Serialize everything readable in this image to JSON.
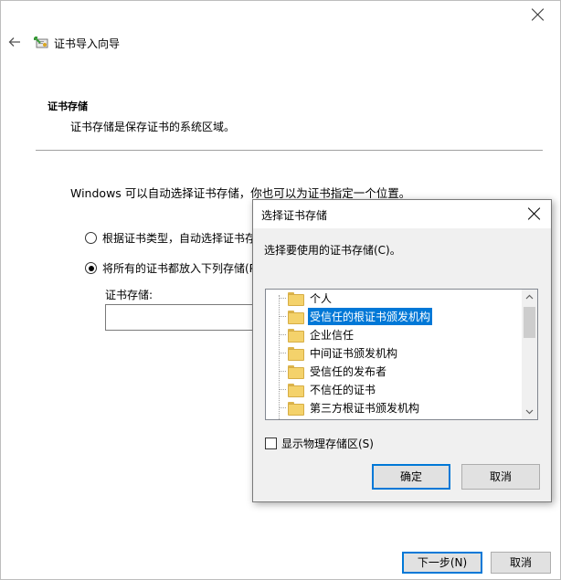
{
  "wizard": {
    "title": "证书导入向导",
    "section_title": "证书存储",
    "section_desc": "证书存储是保存证书的系统区域。",
    "intro": "Windows 可以自动选择证书存储，你也可以为证书指定一个位置。",
    "radio_auto_label": "根据证书类型，自动选择证书存",
    "radio_manual_label": "将所有的证书都放入下列存储(P",
    "store_label": "证书存储:",
    "store_value": "",
    "next_label": "下一步(N)",
    "cancel_label": "取消"
  },
  "dialog": {
    "title": "选择证书存储",
    "prompt": "选择要使用的证书存储(C)。",
    "stores": [
      "个人",
      "受信任的根证书颁发机构",
      "企业信任",
      "中间证书颁发机构",
      "受信任的发布者",
      "不信任的证书",
      "第三方根证书颁发机构"
    ],
    "selected_index": 1,
    "show_physical_label": "显示物理存储区(S)",
    "show_physical_checked": false,
    "ok_label": "确定",
    "cancel_label": "取消"
  },
  "colors": {
    "accent": "#0078d7",
    "button_face": "#e1e1e1",
    "dialog_bg": "#f0f0f0"
  }
}
